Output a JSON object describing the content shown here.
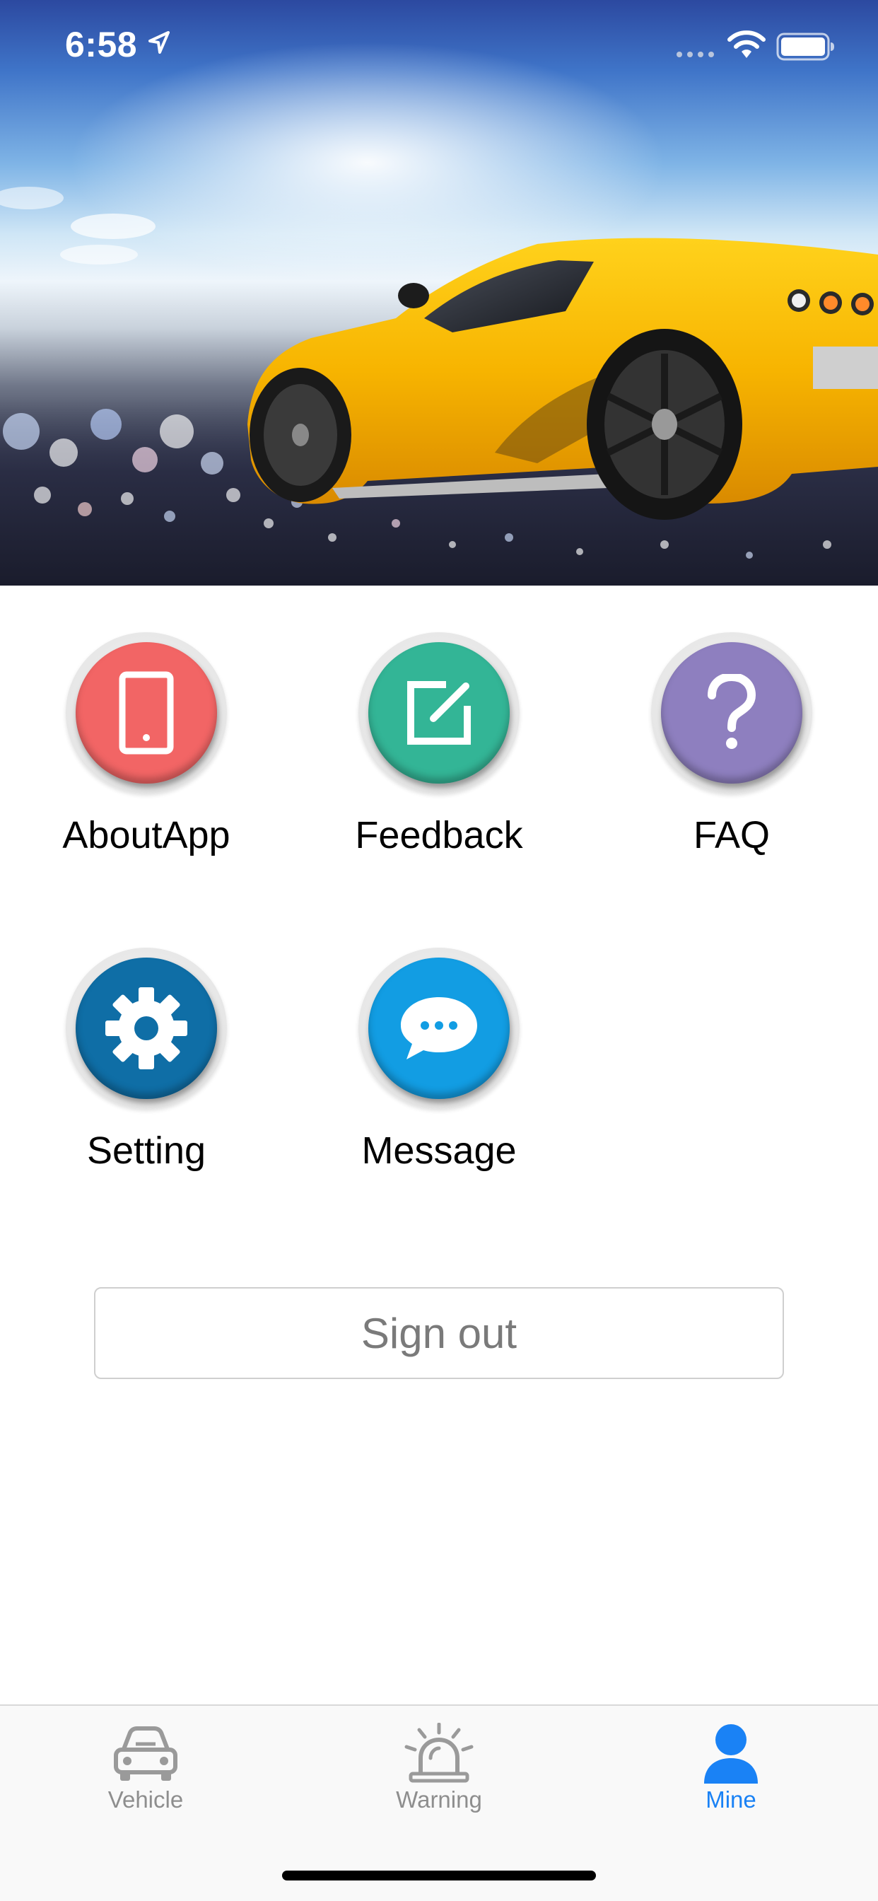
{
  "status_bar": {
    "time": "6:58"
  },
  "menu": {
    "items": [
      {
        "label": "AboutApp",
        "icon": "phone-icon",
        "color": "#f26565"
      },
      {
        "label": "Feedback",
        "icon": "edit-icon",
        "color": "#33b596"
      },
      {
        "label": "FAQ",
        "icon": "question-icon",
        "color": "#8e7fbf"
      },
      {
        "label": "Setting",
        "icon": "gear-icon",
        "color": "#0f6ea6"
      },
      {
        "label": "Message",
        "icon": "chat-bubble-icon",
        "color": "#129de3"
      }
    ]
  },
  "sign_out": {
    "label": "Sign out"
  },
  "tab_bar": {
    "tabs": [
      {
        "label": "Vehicle",
        "icon": "car-icon",
        "active": false
      },
      {
        "label": "Warning",
        "icon": "alarm-light-icon",
        "active": false
      },
      {
        "label": "Mine",
        "icon": "person-icon",
        "active": true
      }
    ],
    "active_color": "#1a82f5",
    "inactive_color": "#8e8e8e"
  }
}
